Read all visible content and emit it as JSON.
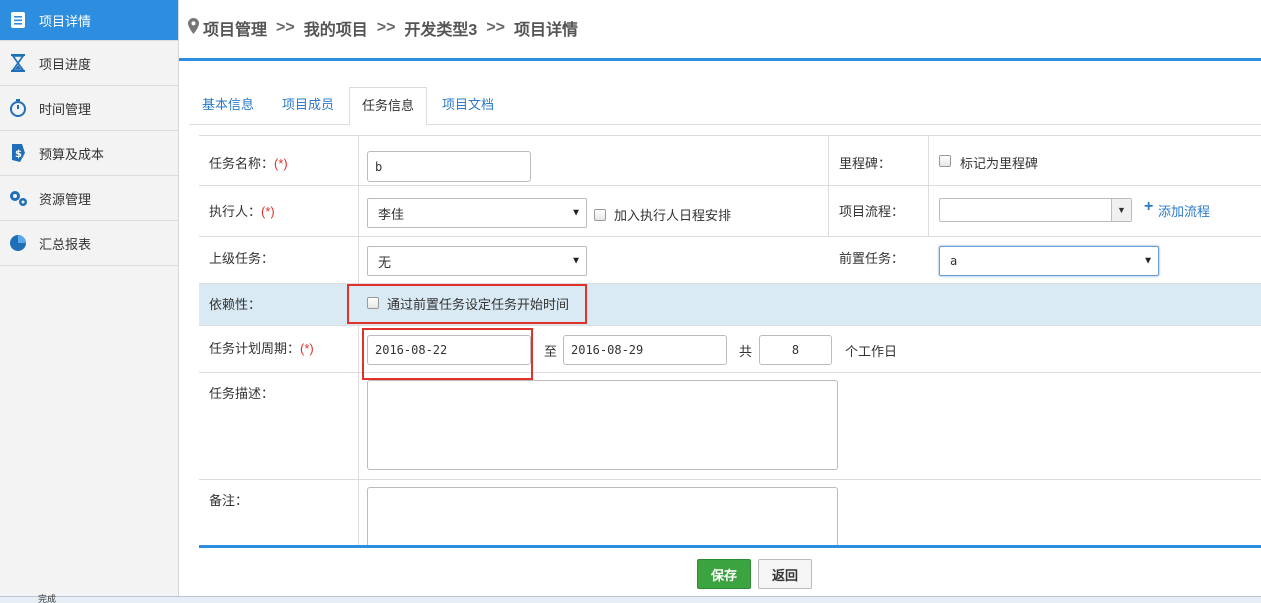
{
  "sidebar": {
    "items": [
      {
        "label": "项目详情",
        "icon": "document-list-icon"
      },
      {
        "label": "项目进度",
        "icon": "hourglass-icon"
      },
      {
        "label": "时间管理",
        "icon": "stopwatch-icon"
      },
      {
        "label": "预算及成本",
        "icon": "dollar-tag-icon"
      },
      {
        "label": "资源管理",
        "icon": "gears-icon"
      },
      {
        "label": "汇总报表",
        "icon": "pie-chart-icon"
      }
    ],
    "accent": "#2d8ee0"
  },
  "breadcrumb": {
    "items": [
      "项目管理",
      "我的项目",
      "开发类型3",
      "项目详情"
    ],
    "separator": ">>"
  },
  "tabs": [
    "基本信息",
    "项目成员",
    "任务信息",
    "项目文档"
  ],
  "form": {
    "task_name": {
      "label": "任务名称：",
      "required": "(*)",
      "value": "b"
    },
    "milestone": {
      "label": "里程碑：",
      "checkbox_label": "标记为里程碑"
    },
    "executor": {
      "label": "执行人：",
      "required": "(*)",
      "value": "李佳",
      "checkbox_label": "加入执行人日程安排"
    },
    "process": {
      "label": "项目流程：",
      "value": "",
      "add_link": "添加流程"
    },
    "parent_task": {
      "label": "上级任务：",
      "value": "无"
    },
    "predecessor": {
      "label": "前置任务：",
      "value": "a"
    },
    "dependency": {
      "label": "依赖性：",
      "checkbox_label": "通过前置任务设定任务开始时间"
    },
    "period": {
      "label": "任务计划周期：",
      "required": "(*)",
      "start": "2016-08-22",
      "to": "至",
      "end": "2016-08-29",
      "total_label": "共",
      "days": "8",
      "unit": "个工作日"
    },
    "description": {
      "label": "任务描述："
    },
    "remark": {
      "label": "备注："
    }
  },
  "buttons": {
    "save": "保存",
    "back": "返回"
  },
  "status": {
    "text": "完成"
  }
}
